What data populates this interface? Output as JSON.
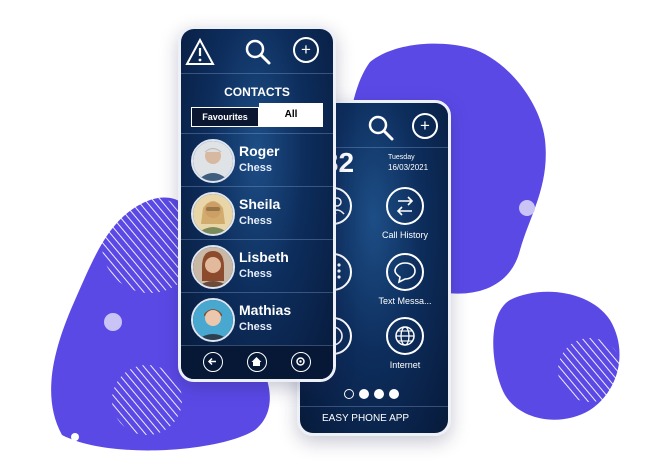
{
  "colors": {
    "blob": "#5b49e6",
    "blob_light": "#c9c3f6",
    "screen_dark": "#071a3a",
    "screen_mid": "#1d4e86",
    "tab_active_bg": "#0b1630",
    "tab_inactive_bg": "#ffffff"
  },
  "contacts_phone": {
    "title": "CONTACTS",
    "tabs": [
      {
        "label": "Favourites",
        "active": true
      },
      {
        "label": "All",
        "active": false
      }
    ],
    "contacts": [
      {
        "name": "Roger",
        "subtitle": "Chess"
      },
      {
        "name": "Sheila",
        "subtitle": "Chess"
      },
      {
        "name": "Lisbeth",
        "subtitle": "Chess"
      },
      {
        "name": "Mathias",
        "subtitle": "Chess"
      }
    ],
    "top_icons": [
      "warning-icon",
      "search-icon",
      "add-icon"
    ],
    "bottom_icons": [
      "back-arrow-icon",
      "home-icon",
      "settings-icon"
    ]
  },
  "home_phone": {
    "time": "2:32",
    "day": "Tuesday",
    "date": "16/03/2021",
    "tiles": [
      {
        "label": "ntacts",
        "icon": "contacts-icon"
      },
      {
        "label": "Call History",
        "icon": "call-history-icon"
      },
      {
        "label": "ect Call",
        "icon": "dialpad-icon"
      },
      {
        "label": "Text Messa...",
        "icon": "message-icon"
      },
      {
        "label": "atsapp",
        "icon": "whatsapp-icon"
      },
      {
        "label": "Internet",
        "icon": "globe-icon"
      }
    ],
    "page_dots": 4,
    "active_dot": 0,
    "footer": "EASY PHONE APP"
  }
}
